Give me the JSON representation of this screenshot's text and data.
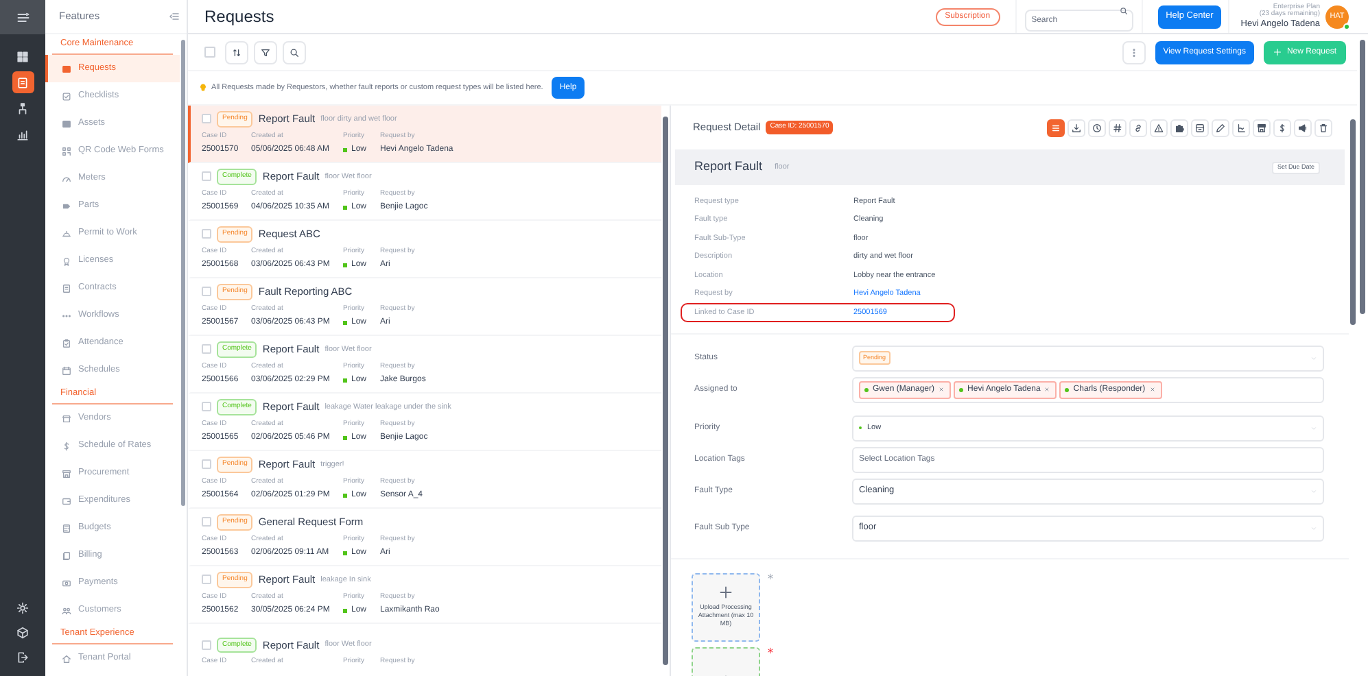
{
  "rail": {
    "items": [
      {
        "selected": false
      },
      {
        "selected": true
      },
      {
        "selected": false
      },
      {
        "selected": false
      }
    ]
  },
  "features": {
    "title": "Features",
    "sections": [
      {
        "heading": "Core Maintenance",
        "items": [
          {
            "label": "Requests",
            "selected": true
          },
          {
            "label": "Checklists",
            "selected": false
          },
          {
            "label": "Assets",
            "selected": false
          },
          {
            "label": "QR Code Web Forms",
            "selected": false
          },
          {
            "label": "Meters",
            "selected": false
          },
          {
            "label": "Parts",
            "selected": false
          },
          {
            "label": "Permit to Work",
            "selected": false
          },
          {
            "label": "Licenses",
            "selected": false
          },
          {
            "label": "Contracts",
            "selected": false
          },
          {
            "label": "Workflows",
            "selected": false
          },
          {
            "label": "Attendance",
            "selected": false
          },
          {
            "label": "Schedules",
            "selected": false
          }
        ]
      },
      {
        "heading": "Financial",
        "items": [
          {
            "label": "Vendors",
            "selected": false
          },
          {
            "label": "Schedule of Rates",
            "selected": false
          },
          {
            "label": "Procurement",
            "selected": false
          },
          {
            "label": "Expenditures",
            "selected": false
          },
          {
            "label": "Budgets",
            "selected": false
          },
          {
            "label": "Billing",
            "selected": false
          },
          {
            "label": "Payments",
            "selected": false
          },
          {
            "label": "Customers",
            "selected": false
          }
        ]
      },
      {
        "heading": "Tenant Experience",
        "items": [
          {
            "label": "Tenant Portal",
            "selected": false
          }
        ]
      }
    ]
  },
  "page_title": "Requests",
  "header": {
    "subscription": "Subscription",
    "search_placeholder": "Search",
    "help_center": "Help Center",
    "plan": "Enterprise Plan",
    "days_remaining": "(23 days remaining)",
    "user": "Hevi Angelo Tadena",
    "avatar": "HAT"
  },
  "toolbar": {
    "select_all_checked": false,
    "view_settings": "View Request Settings",
    "new_request": "New Request"
  },
  "notice": {
    "text": "All Requests made by Requestors, whether fault reports or custom request types will be listed here.",
    "help": "Help"
  },
  "requests": [
    {
      "kind": "pending",
      "status": "Pending",
      "title": "Report Fault",
      "subtitle": "floor dirty and wet floor",
      "selected": true,
      "checked": false,
      "fields": [
        {
          "label": "Case ID",
          "value": "25001570"
        },
        {
          "label": "Created at",
          "value": "05/06/2025 06:48 AM"
        },
        {
          "label": "Priority",
          "value": "Low"
        },
        {
          "label": "Request by",
          "value": "Hevi Angelo Tadena"
        }
      ]
    },
    {
      "kind": "complete",
      "status": "Complete",
      "title": "Report Fault",
      "subtitle": "floor Wet floor",
      "selected": false,
      "checked": false,
      "fields": [
        {
          "label": "Case ID",
          "value": "25001569"
        },
        {
          "label": "Created at",
          "value": "04/06/2025 10:35 AM"
        },
        {
          "label": "Priority",
          "value": "Low"
        },
        {
          "label": "Request by",
          "value": "Benjie Lagoc"
        }
      ]
    },
    {
      "kind": "pending",
      "status": "Pending",
      "title": "Request ABC",
      "selected": false,
      "checked": false,
      "fields": [
        {
          "label": "Case ID",
          "value": "25001568"
        },
        {
          "label": "Created at",
          "value": "03/06/2025 06:43 PM"
        },
        {
          "label": "Priority",
          "value": "Low"
        },
        {
          "label": "Request by",
          "value": "Ari"
        }
      ]
    },
    {
      "kind": "pending",
      "status": "Pending",
      "title": "Fault Reporting ABC",
      "selected": false,
      "checked": false,
      "fields": [
        {
          "label": "Case ID",
          "value": "25001567"
        },
        {
          "label": "Created at",
          "value": "03/06/2025 06:43 PM"
        },
        {
          "label": "Priority",
          "value": "Low"
        },
        {
          "label": "Request by",
          "value": "Ari"
        }
      ]
    },
    {
      "kind": "complete",
      "status": "Complete",
      "title": "Report Fault",
      "subtitle": "floor Wet floor",
      "selected": false,
      "checked": false,
      "fields": [
        {
          "label": "Case ID",
          "value": "25001566"
        },
        {
          "label": "Created at",
          "value": "03/06/2025 02:29 PM"
        },
        {
          "label": "Priority",
          "value": "Low"
        },
        {
          "label": "Request by",
          "value": "Jake Burgos"
        }
      ]
    },
    {
      "kind": "complete",
      "status": "Complete",
      "title": "Report Fault",
      "subtitle": "leakage Water leakage under the sink",
      "selected": false,
      "checked": false,
      "fields": [
        {
          "label": "Case ID",
          "value": "25001565"
        },
        {
          "label": "Created at",
          "value": "02/06/2025 05:46 PM"
        },
        {
          "label": "Priority",
          "value": "Low"
        },
        {
          "label": "Request by",
          "value": "Benjie Lagoc"
        }
      ]
    },
    {
      "kind": "pending",
      "status": "Pending",
      "title": "Report Fault",
      "subtitle": "trigger!",
      "selected": false,
      "checked": false,
      "fields": [
        {
          "label": "Case ID",
          "value": "25001564"
        },
        {
          "label": "Created at",
          "value": "02/06/2025 01:29 PM"
        },
        {
          "label": "Priority",
          "value": "Low"
        },
        {
          "label": "Request by",
          "value": "Sensor A_4"
        }
      ]
    },
    {
      "kind": "pending",
      "status": "Pending",
      "title": "General Request Form",
      "selected": false,
      "checked": false,
      "fields": [
        {
          "label": "Case ID",
          "value": "25001563"
        },
        {
          "label": "Created at",
          "value": "02/06/2025 09:11 AM"
        },
        {
          "label": "Priority",
          "value": "Low"
        },
        {
          "label": "Request by",
          "value": "Ari"
        }
      ]
    },
    {
      "kind": "pending",
      "status": "Pending",
      "title": "Report Fault",
      "subtitle": "leakage In sink",
      "selected": false,
      "checked": false,
      "fields": [
        {
          "label": "Case ID",
          "value": "25001562"
        },
        {
          "label": "Created at",
          "value": "30/05/2025 06:24 PM"
        },
        {
          "label": "Priority",
          "value": "Low"
        },
        {
          "label": "Request by",
          "value": "Laxmikanth Rao"
        }
      ]
    },
    {
      "kind": "complete",
      "status": "Complete",
      "title": "Report Fault",
      "subtitle": "floor Wet floor",
      "selected": false,
      "checked": false,
      "fields": [
        {
          "label": "Case ID"
        },
        {
          "label": "Created at"
        },
        {
          "label": "Priority"
        },
        {
          "label": "Request by"
        }
      ]
    }
  ],
  "detail": {
    "title": "Request Detail",
    "case_badge": "Case ID: 25001570",
    "actions": [
      {
        "selected": true
      },
      {
        "selected": false
      },
      {
        "selected": false
      },
      {
        "selected": false
      },
      {
        "selected": false
      },
      {
        "selected": false
      },
      {
        "selected": false
      },
      {
        "selected": false
      },
      {
        "selected": false
      },
      {
        "selected": false
      },
      {
        "selected": false
      },
      {
        "selected": false
      },
      {
        "selected": false
      },
      {
        "selected": false
      }
    ],
    "heading": "Report Fault",
    "heading_sub": "floor",
    "due_button": "Set Due Date",
    "info": [
      {
        "label": "Request type",
        "value": "Report Fault",
        "kind": "text"
      },
      {
        "label": "Fault type",
        "value": "Cleaning",
        "kind": "text"
      },
      {
        "label": "Fault Sub-Type",
        "value": "floor",
        "kind": "text"
      },
      {
        "label": "Description",
        "value": "dirty and wet floor",
        "kind": "text"
      },
      {
        "label": "Location",
        "value": "Lobby near the entrance",
        "kind": "text"
      },
      {
        "label": "Request by",
        "value": "Hevi Angelo Tadena",
        "kind": "link"
      },
      {
        "label": "Linked to Case ID",
        "value": "25001569",
        "kind": "link",
        "highlighted": true
      }
    ],
    "form": [
      {
        "label": "Status",
        "kind": "badge",
        "value": "Pending"
      },
      {
        "label": "Assigned to",
        "kind": "tags",
        "tags": [
          "Gwen (Manager)",
          "Hevi Angelo Tadena",
          "Charls (Responder)"
        ]
      },
      {
        "label": "Priority",
        "kind": "priority",
        "value": "Low"
      },
      {
        "label": "Location Tags",
        "kind": "text",
        "placeholder": "Select Location Tags"
      },
      {
        "label": "Fault Type",
        "kind": "select",
        "value": "Cleaning"
      },
      {
        "label": "Fault Sub Type",
        "kind": "select",
        "value": "floor"
      }
    ],
    "uploads": [
      {
        "kind": "processing",
        "label": "Upload Processing Attachment (max 10 MB)"
      },
      {
        "kind": "required"
      }
    ]
  }
}
